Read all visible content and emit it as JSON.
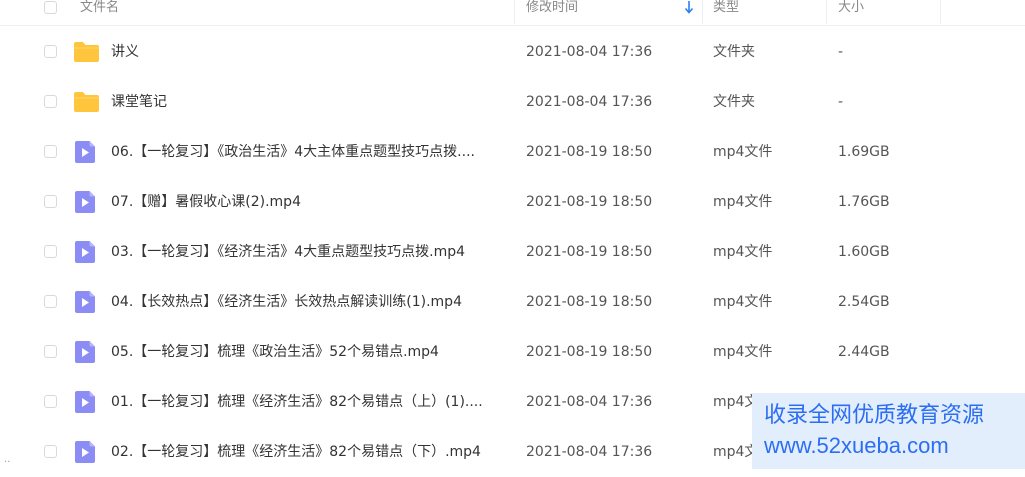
{
  "header": {
    "name_label": "文件名",
    "modified_label": "修改时间",
    "type_label": "类型",
    "size_label": "大小"
  },
  "files": [
    {
      "name": "讲义",
      "modified": "2021-08-04 17:36",
      "type": "文件夹",
      "size": "-",
      "icon": "folder-icon"
    },
    {
      "name": "课堂笔记",
      "modified": "2021-08-04 17:36",
      "type": "文件夹",
      "size": "-",
      "icon": "folder-icon"
    },
    {
      "name": "06.【一轮复习】《政治生活》4大主体重点题型技巧点拨....",
      "modified": "2021-08-19 18:50",
      "type": "mp4文件",
      "size": "1.69GB",
      "icon": "video-file-icon"
    },
    {
      "name": "07.【赠】暑假收心课(2).mp4",
      "modified": "2021-08-19 18:50",
      "type": "mp4文件",
      "size": "1.76GB",
      "icon": "video-file-icon"
    },
    {
      "name": "03.【一轮复习】《经济生活》4大重点题型技巧点拨.mp4",
      "modified": "2021-08-19 18:50",
      "type": "mp4文件",
      "size": "1.60GB",
      "icon": "video-file-icon"
    },
    {
      "name": "04.【长效热点】《经济生活》长效热点解读训练(1).mp4",
      "modified": "2021-08-19 18:50",
      "type": "mp4文件",
      "size": "2.54GB",
      "icon": "video-file-icon"
    },
    {
      "name": "05.【一轮复习】梳理《政治生活》52个易错点.mp4",
      "modified": "2021-08-19 18:50",
      "type": "mp4文件",
      "size": "2.44GB",
      "icon": "video-file-icon"
    },
    {
      "name": "01.【一轮复习】梳理《经济生活》82个易错点（上）(1)....",
      "modified": "2021-08-04 17:36",
      "type": "mp4文",
      "size": "",
      "icon": "video-file-icon"
    },
    {
      "name": "02.【一轮复习】梳理《经济生活》82个易错点（下）.mp4",
      "modified": "2021-08-04 17:36",
      "type": "mp4文",
      "size": "",
      "icon": "video-file-icon"
    }
  ],
  "watermark": {
    "line1": "收录全网优质教育资源",
    "line2": "www.52xueba.com"
  },
  "edge_mark": "..",
  "colors": {
    "folder": "#ffc53d",
    "video_icon": "#8c8cf5",
    "watermark_bg": "#e3eefc",
    "watermark_text": "#2c6ef2",
    "sort_arrow": "#2c7ef8"
  }
}
